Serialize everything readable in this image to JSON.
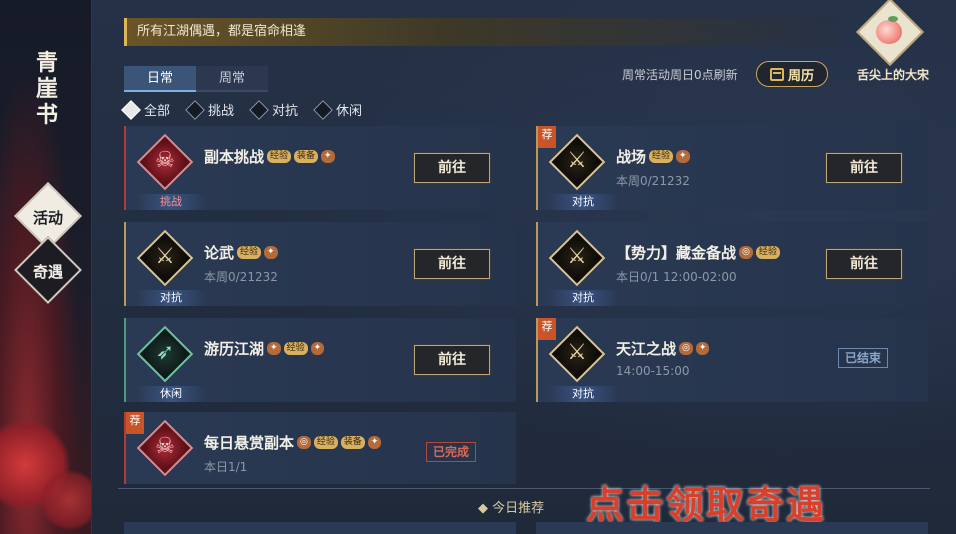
{
  "sidebar": {
    "title": "青崖书",
    "tabs": [
      {
        "label": "活动",
        "active": true
      },
      {
        "label": "奇遇",
        "active": false
      }
    ]
  },
  "header": {
    "banner_text": "所有江湖偶遇，都是宿命相逢",
    "avatar_label": "舌尖上的大宋",
    "refresh_note": "周常活动周日0点刷新",
    "calendar_label": "周历"
  },
  "tabs": [
    {
      "label": "日常",
      "active": true
    },
    {
      "label": "周常",
      "active": false
    }
  ],
  "filters": [
    {
      "label": "全部",
      "selected": true
    },
    {
      "label": "挑战",
      "selected": false
    },
    {
      "label": "对抗",
      "selected": false
    },
    {
      "label": "休闲",
      "selected": false
    }
  ],
  "activities": [
    {
      "title": "副本挑战",
      "sub": "",
      "tag": "挑战",
      "rewards": [
        "经验",
        "装备",
        "item"
      ],
      "action": "前往",
      "recommended": false
    },
    {
      "title": "战场",
      "sub": "本周0/21232",
      "tag": "对抗",
      "rewards": [
        "经验",
        "item"
      ],
      "action": "前往",
      "recommended": true
    },
    {
      "title": "论武",
      "sub": "本周0/21232",
      "tag": "对抗",
      "rewards": [
        "经验",
        "item"
      ],
      "action": "前往",
      "recommended": false
    },
    {
      "title": "【势力】藏金备战",
      "sub": "本日0/1   12:00-02:00",
      "tag": "对抗",
      "rewards": [
        "coin",
        "经验"
      ],
      "action": "前往",
      "recommended": false
    },
    {
      "title": "游历江湖",
      "sub": "",
      "tag": "休闲",
      "rewards": [
        "item",
        "经验",
        "item"
      ],
      "action": "前往",
      "recommended": false
    },
    {
      "title": "天江之战",
      "sub": "14:00-15:00",
      "tag": "对抗",
      "rewards": [
        "coin",
        "item"
      ],
      "status": "已结束",
      "recommended": true
    },
    {
      "title": "每日悬赏副本",
      "sub": "本日1/1",
      "tag": "",
      "rewards": [
        "coin",
        "经验",
        "装备",
        "item"
      ],
      "status": "已完成",
      "recommended": true
    }
  ],
  "recommend_badge": "荐",
  "section_label": "今日推荐",
  "promo_text": "点击领取奇遇"
}
